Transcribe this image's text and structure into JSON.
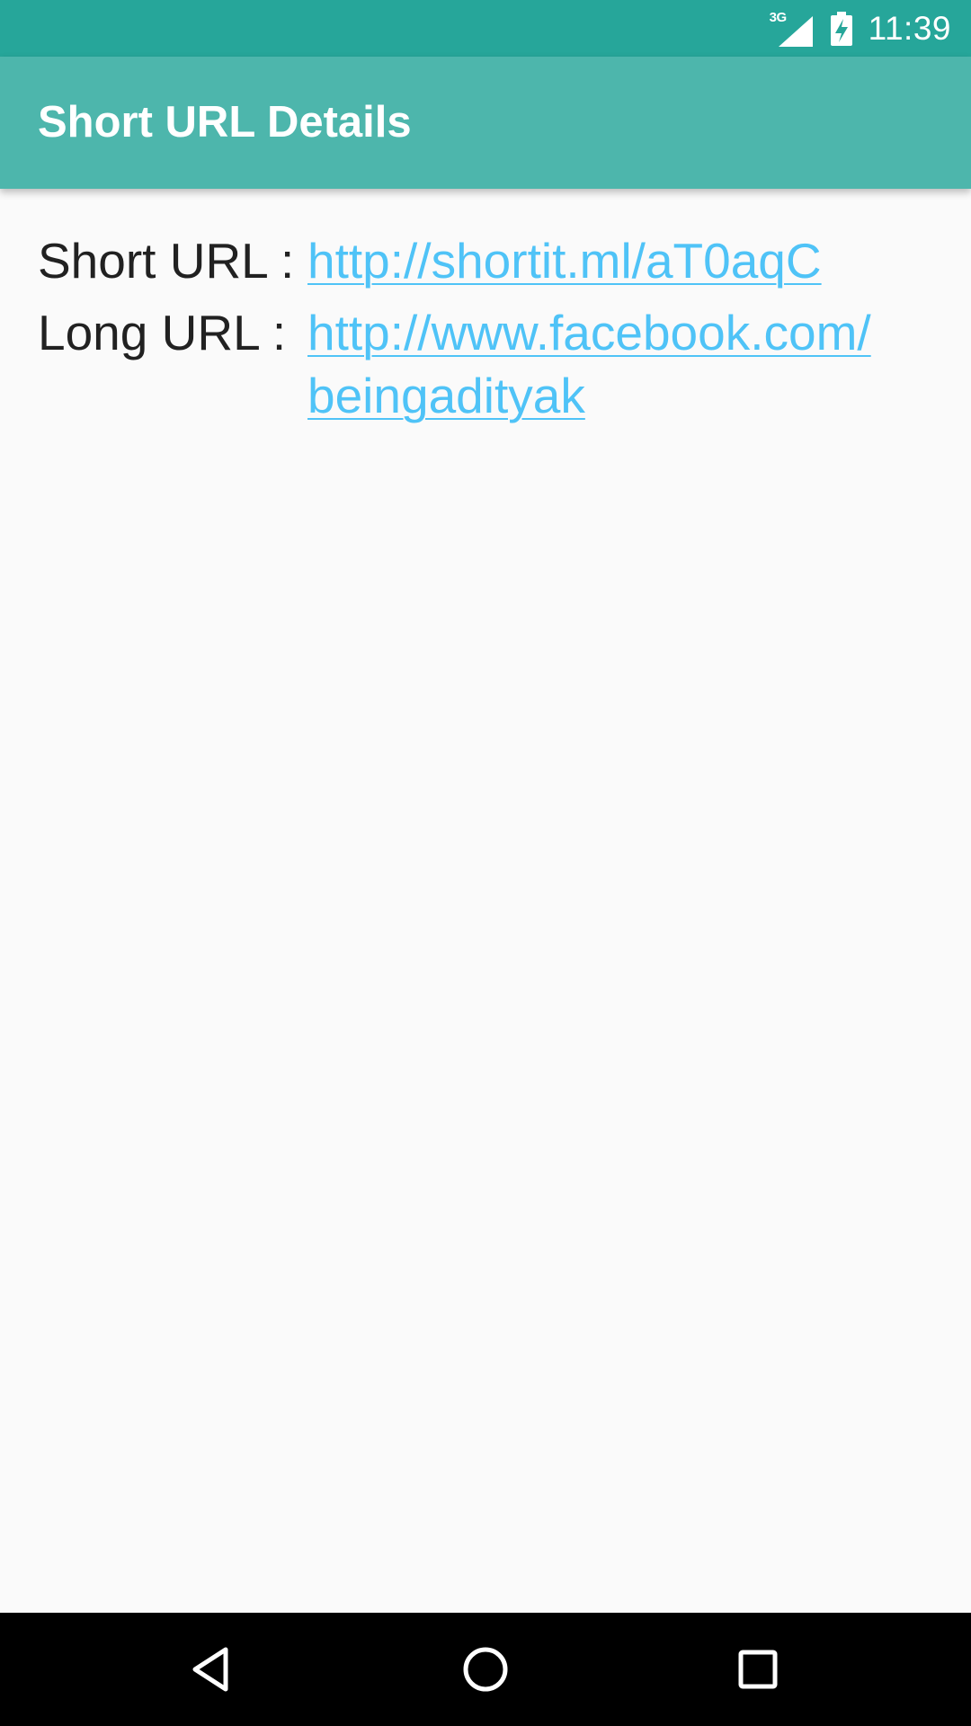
{
  "status_bar": {
    "network_type": "3G",
    "signal_icon": "cell-signal-icon",
    "battery_icon": "battery-charging-icon",
    "time": "11:39"
  },
  "app_bar": {
    "title": "Short URL Details"
  },
  "details": {
    "short_url_label": "Short URL :",
    "short_url_value": "http://shortit.ml/aT0aqC",
    "long_url_label": "Long URL :",
    "long_url_line1": "http://www.facebook.com/",
    "long_url_line2": "beingadityak"
  },
  "nav_bar": {
    "back_icon": "back-triangle-icon",
    "home_icon": "home-circle-icon",
    "recents_icon": "recents-square-icon"
  },
  "colors": {
    "status_bar": "#26a69a",
    "app_bar": "#4db6ac",
    "link": "#4fc3f7",
    "text": "#212121",
    "background": "#fafafa"
  }
}
